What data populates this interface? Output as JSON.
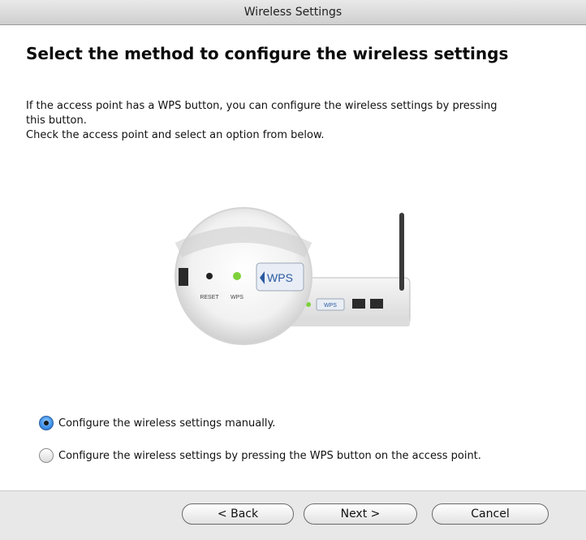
{
  "window": {
    "title": "Wireless Settings"
  },
  "page": {
    "heading": "Select the method to configure the wireless settings",
    "description_lines": [
      "If the access point has a WPS button, you can configure the wireless settings by pressing",
      "this button.",
      "Check the access point and select an option from below."
    ]
  },
  "illustration": {
    "reset_label": "RESET",
    "wps_led_label": "WPS",
    "wps_button_label": "WPS",
    "small_wps_label": "WPS",
    "led_color": "#7fd13b"
  },
  "options": [
    {
      "label": "Configure the wireless settings manually.",
      "selected": true
    },
    {
      "label": "Configure the wireless settings by pressing the WPS button on the access point.",
      "selected": false
    }
  ],
  "buttons": {
    "back": "< Back",
    "next": "Next >",
    "cancel": "Cancel"
  }
}
